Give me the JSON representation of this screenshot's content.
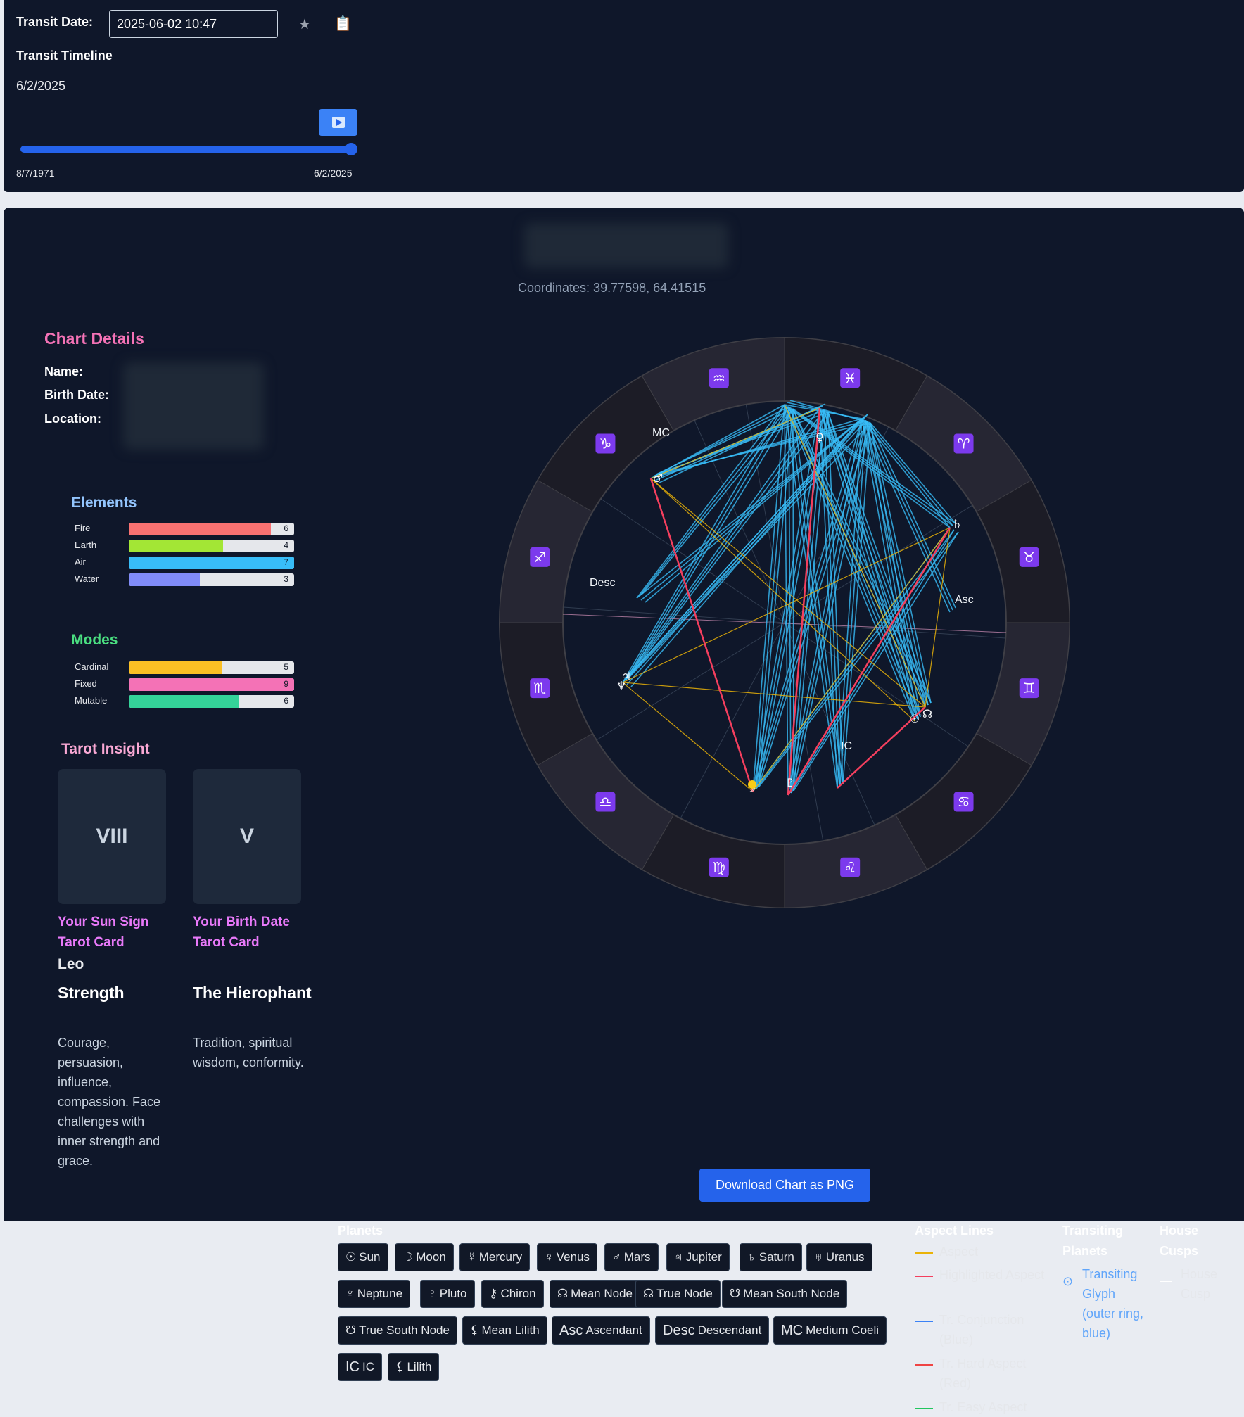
{
  "transit": {
    "label": "Transit Date:",
    "date_value": "2025-06-02 10:47",
    "favorite_icon": "star-icon",
    "copy_icon": "clipboard-icon",
    "timeline_title": "Transit Timeline",
    "current_date": "6/2/2025",
    "slider_start": "8/7/1971",
    "slider_end": "6/2/2025",
    "slider_position": 1.0
  },
  "chart": {
    "coordinates": "Coordinates: 39.77598, 64.41515",
    "download_label": "Download Chart as PNG",
    "zodiac_signs": [
      "♓",
      "♈",
      "♉",
      "♊",
      "♋",
      "♌",
      "♍",
      "♎",
      "♏",
      "♐",
      "♑",
      "♒"
    ],
    "angle_labels": {
      "mc": "MC",
      "desc": "Desc",
      "asc": "Asc",
      "ic": "IC"
    },
    "planet_glyphs_on_wheel": [
      "♂",
      "♃",
      "♄",
      "♆",
      "♇",
      "☉",
      "☊",
      "☽",
      "♀"
    ]
  },
  "details": {
    "title": "Chart Details",
    "name_label": "Name:",
    "birth_label": "Birth Date:",
    "location_label": "Location:"
  },
  "elements": {
    "title": "Elements",
    "items": [
      {
        "name": "Fire",
        "value": 6,
        "color": "#f87171",
        "fill": 0.86
      },
      {
        "name": "Earth",
        "value": 4,
        "color": "#a3e635",
        "fill": 0.57
      },
      {
        "name": "Air",
        "value": 7,
        "color": "#38bdf8",
        "fill": 1.0
      },
      {
        "name": "Water",
        "value": 3,
        "color": "#818cf8",
        "fill": 0.43
      }
    ]
  },
  "modes": {
    "title": "Modes",
    "items": [
      {
        "name": "Cardinal",
        "value": 5,
        "color": "#fbbf24",
        "fill": 0.56
      },
      {
        "name": "Fixed",
        "value": 9,
        "color": "#f472b6",
        "fill": 1.0
      },
      {
        "name": "Mutable",
        "value": 6,
        "color": "#34d399",
        "fill": 0.67
      }
    ]
  },
  "tarot": {
    "title": "Tarot Insight",
    "sun_card": {
      "numeral": "VIII",
      "label": "Your Sun Sign Tarot Card",
      "sign": "Leo",
      "name": "Strength",
      "desc": "Courage, persuasion, influence, compassion. Face challenges with inner strength and grace."
    },
    "birth_card": {
      "numeral": "V",
      "label": "Your Birth Date Tarot Card",
      "name": "The Hierophant",
      "desc": "Tradition, spiritual wisdom, conformity."
    }
  },
  "planets": {
    "title": "Planets",
    "chips": [
      {
        "glyph": "☉",
        "label": "Sun"
      },
      {
        "glyph": "☽",
        "label": "Moon"
      },
      {
        "glyph": "☿",
        "label": "Mercury"
      },
      {
        "glyph": "♀",
        "label": "Venus"
      },
      {
        "glyph": "♂",
        "label": "Mars"
      },
      {
        "glyph": "♃",
        "label": "Jupiter"
      },
      {
        "glyph": "♄",
        "label": "Saturn"
      },
      {
        "glyph": "♅",
        "label": "Uranus"
      },
      {
        "glyph": "♆",
        "label": "Neptune"
      },
      {
        "glyph": "♇",
        "label": "Pluto"
      },
      {
        "glyph": "⚷",
        "label": "Chiron"
      },
      {
        "glyph": "☊",
        "label": "Mean Node"
      },
      {
        "glyph": "☊",
        "label": "True Node"
      },
      {
        "glyph": "☋",
        "label": "Mean South Node"
      },
      {
        "glyph": "☋",
        "label": "True South Node"
      },
      {
        "glyph": "⚸",
        "label": "Mean Lilith"
      },
      {
        "glyph": "Asc",
        "label": "Ascendant"
      },
      {
        "glyph": "Desc",
        "label": "Descendant"
      },
      {
        "glyph": "MC",
        "label": "Medium Coeli"
      },
      {
        "glyph": "IC",
        "label": "IC"
      },
      {
        "glyph": "⚸",
        "label": "Lilith"
      }
    ]
  },
  "legend": {
    "aspect_title": "Aspect Lines",
    "aspect_items": [
      {
        "label": "Aspect",
        "color": "#eab308"
      },
      {
        "label": "Highlighted Aspect",
        "color": "#f43f5e"
      },
      {
        "label": "Tr. Conjunction (Blue)",
        "color": "#3b82f6"
      },
      {
        "label": "Tr. Hard Aspect (Red)",
        "color": "#ef4444"
      },
      {
        "label": "Tr. Easy Aspect",
        "color": "#22c55e"
      }
    ],
    "transit_title": "Transiting Planets",
    "transit_glyph": "⊙",
    "transit_item": "Transiting Glyph (outer ring, blue)",
    "house_title": "House Cusps",
    "house_item": "House Cusp"
  }
}
